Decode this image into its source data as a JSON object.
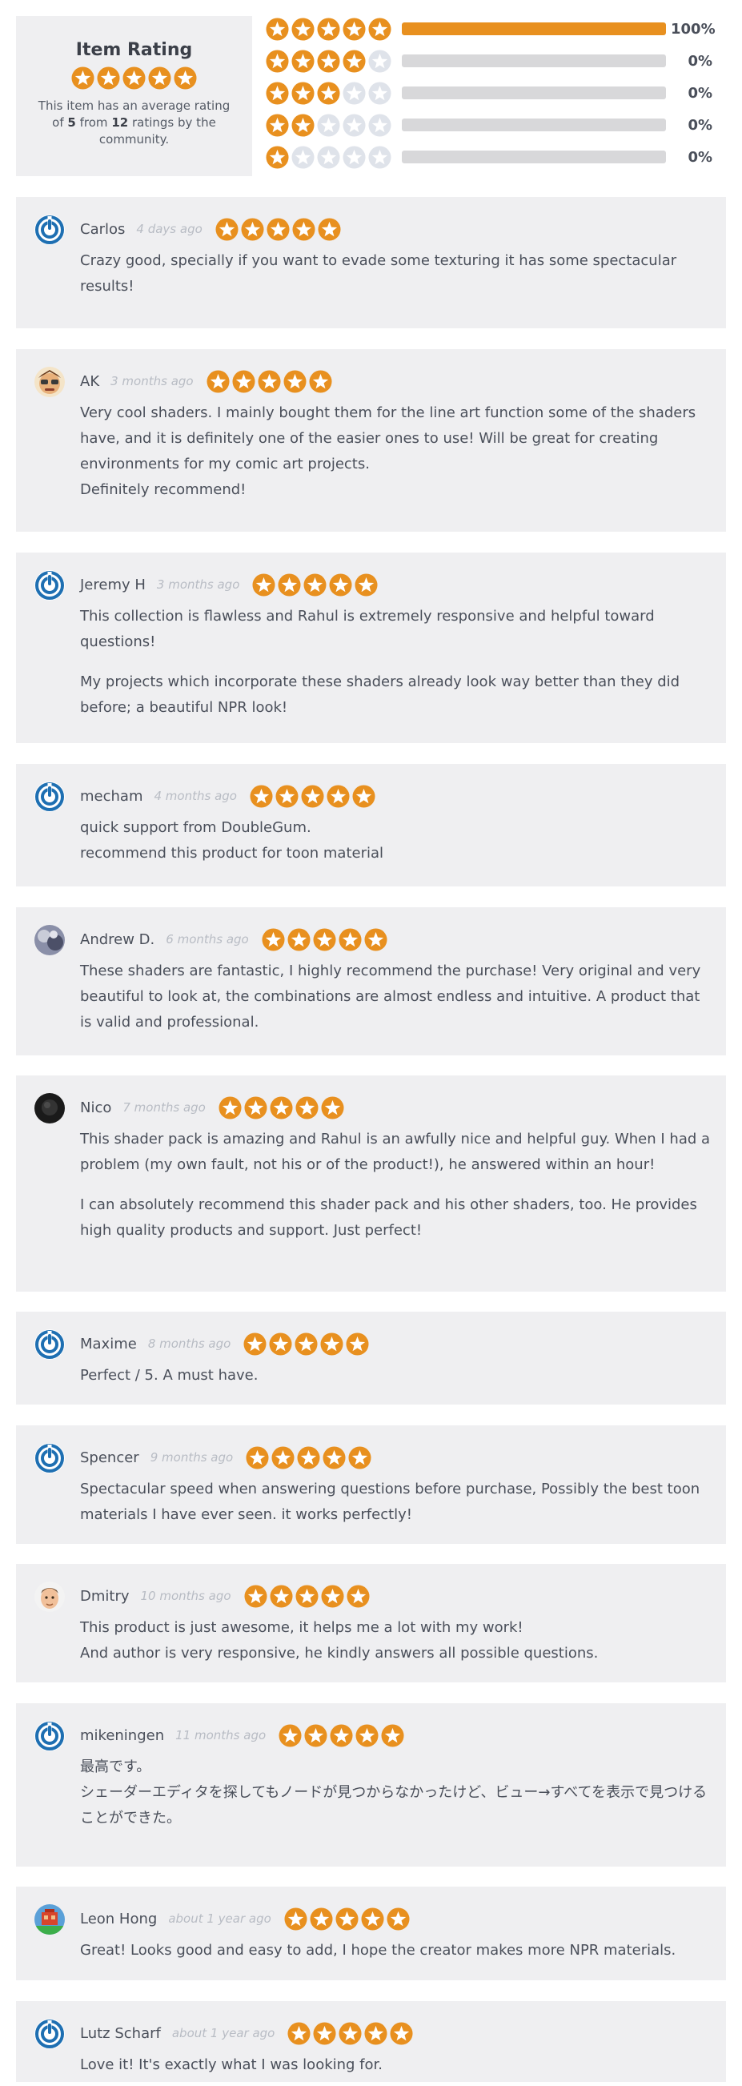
{
  "summary": {
    "title": "Item Rating",
    "desc_prefix": "This item has an average rating of",
    "avg": "5",
    "desc_middle": "from",
    "count": "12",
    "desc_suffix": "ratings by the community.",
    "rating": 5,
    "bars": [
      {
        "stars": 5,
        "fraction": 1.0,
        "pct": "100%"
      },
      {
        "stars": 4,
        "fraction": 0,
        "pct": "0%"
      },
      {
        "stars": 3,
        "fraction": 0,
        "pct": "0%"
      },
      {
        "stars": 2,
        "fraction": 0,
        "pct": "0%"
      },
      {
        "stars": 1,
        "fraction": 0,
        "pct": "0%"
      }
    ]
  },
  "colors": {
    "star_filled": "#e8901f",
    "star_empty": "#dfe3ea",
    "bar_fill": "#e8901f",
    "bar_track": "#d8d8da",
    "card_bg": "#efeff1",
    "blender_blue": "#1e6fb2"
  },
  "reviews": [
    {
      "name": "Carlos",
      "time": "4 days ago",
      "rating": 5,
      "avatar": "blender-logo-icon",
      "paragraphs": [
        "Crazy good, specially if you want to evade some texturing it has some spectacular results!"
      ]
    },
    {
      "name": "AK",
      "time": "3 months ago",
      "rating": 5,
      "avatar": "cartoon-face-avatar",
      "paragraphs": [
        "Very cool shaders. I mainly bought them for the line art function some of the shaders have, and it is definitely one of the easier ones to use! Will be great for creating environments for my comic art projects.\nDefinitely recommend!"
      ]
    },
    {
      "name": "Jeremy H",
      "time": "3 months ago",
      "rating": 5,
      "avatar": "blender-logo-icon",
      "paragraphs": [
        "This collection is flawless and Rahul is extremely responsive and helpful toward questions!",
        "My projects which incorporate these shaders already look way better than they did before; a beautiful NPR look!"
      ]
    },
    {
      "name": "mecham",
      "time": "4 months ago",
      "rating": 5,
      "avatar": "blender-logo-icon",
      "paragraphs": [
        "quick support from DoubleGum.\nrecommend this product for toon material"
      ]
    },
    {
      "name": "Andrew D.",
      "time": "6 months ago",
      "rating": 5,
      "avatar": "photo-avatar",
      "paragraphs": [
        "These shaders are fantastic, I highly recommend the purchase! Very original and very beautiful to look at, the combinations are almost endless and intuitive. A product that is valid and professional."
      ]
    },
    {
      "name": "Nico",
      "time": "7 months ago",
      "rating": 5,
      "avatar": "dark-photo-avatar",
      "paragraphs": [
        "This shader pack is amazing and Rahul is an awfully nice and helpful guy. When I had a problem (my own fault, not his or of the product!), he answered within an hour!",
        "I can absolutely recommend this shader pack and his other shaders, too. He provides high quality products and support. Just perfect!"
      ]
    },
    {
      "name": "Maxime",
      "time": "8 months ago",
      "rating": 5,
      "avatar": "blender-logo-icon",
      "paragraphs": [
        "Perfect / 5. A must have."
      ]
    },
    {
      "name": "Spencer",
      "time": "9 months ago",
      "rating": 5,
      "avatar": "blender-logo-icon",
      "paragraphs": [
        "Spectacular speed when answering questions before purchase, Possibly the best toon materials I have ever seen. it works perfectly!"
      ]
    },
    {
      "name": "Dmitry",
      "time": "10 months ago",
      "rating": 5,
      "avatar": "cartoon-man-avatar",
      "paragraphs": [
        "This product is just awesome, it helps me a lot with my work!\nAnd author is very responsive, he kindly answers all possible questions."
      ]
    },
    {
      "name": "mikeningen",
      "time": "11 months ago",
      "rating": 5,
      "avatar": "blender-logo-icon",
      "paragraphs": [
        "最高です。\nシェーダーエディタを探してもノードが見つからなかったけど、ビュー→すべてを表示で見つけることができた。"
      ]
    },
    {
      "name": "Leon Hong",
      "time": "about 1 year ago",
      "rating": 5,
      "avatar": "pixel-art-avatar",
      "paragraphs": [
        "Great! Looks good and easy to add, I hope the creator makes more NPR materials."
      ]
    },
    {
      "name": "Lutz Scharf",
      "time": "about 1 year ago",
      "rating": 5,
      "avatar": "blender-logo-icon",
      "paragraphs": [
        "Love it! It's exactly what I was looking for."
      ]
    }
  ]
}
